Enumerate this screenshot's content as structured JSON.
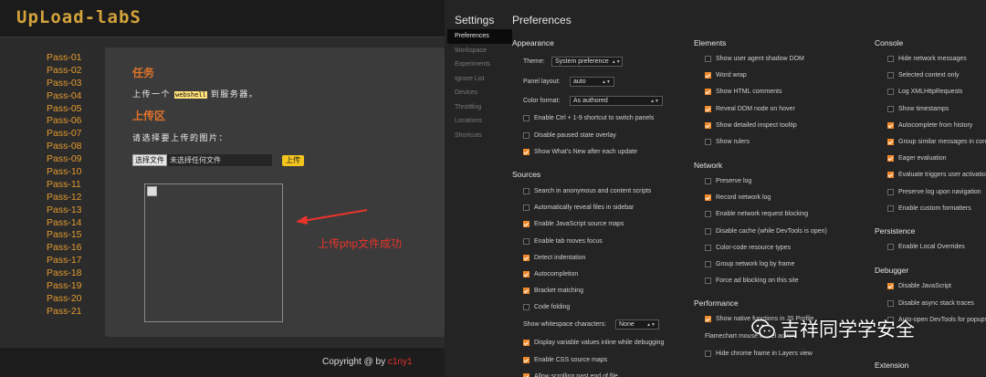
{
  "left": {
    "logo": "UpLoad-labS",
    "pass_items": [
      "Pass-01",
      "Pass-02",
      "Pass-03",
      "Pass-04",
      "Pass-05",
      "Pass-06",
      "Pass-07",
      "Pass-08",
      "Pass-09",
      "Pass-10",
      "Pass-11",
      "Pass-12",
      "Pass-13",
      "Pass-14",
      "Pass-15",
      "Pass-16",
      "Pass-17",
      "Pass-18",
      "Pass-19",
      "Pass-20",
      "Pass-21"
    ],
    "task_heading": "任务",
    "task_text_before": "上传一个",
    "task_code": "webshell",
    "task_text_after": "到服务器。",
    "upload_heading": "上传区",
    "upload_prompt": "请选择要上传的图片：",
    "choose_file_button": "选择文件",
    "no_file_text": "未选择任何文件",
    "upload_button": "上传",
    "annotation": "上传php文件成功",
    "copyright": "Copyright @  by",
    "author": "c1ny1"
  },
  "devtools": {
    "settings_title": "Settings",
    "preferences_title": "Preferences",
    "nav": [
      "Preferences",
      "Workspace",
      "Experiments",
      "Ignore List",
      "Devices",
      "Throttling",
      "Locations",
      "Shortcuts"
    ],
    "appearance": {
      "heading": "Appearance",
      "theme_label": "Theme:",
      "theme_value": "System preference",
      "panel_layout_label": "Panel layout:",
      "panel_layout_value": "auto",
      "color_format_label": "Color format:",
      "color_format_value": "As authored",
      "options": [
        {
          "label": "Enable Ctrl + 1-9 shortcut to switch panels",
          "checked": false
        },
        {
          "label": "Disable paused state overlay",
          "checked": false
        },
        {
          "label": "Show What's New after each update",
          "checked": true
        }
      ]
    },
    "sources": {
      "heading": "Sources",
      "options": [
        {
          "label": "Search in anonymous and content scripts",
          "checked": false
        },
        {
          "label": "Automatically reveal files in sidebar",
          "checked": false
        },
        {
          "label": "Enable JavaScript source maps",
          "checked": true
        },
        {
          "label": "Enable tab moves focus",
          "checked": false
        },
        {
          "label": "Detect indentation",
          "checked": true
        },
        {
          "label": "Autocompletion",
          "checked": true
        },
        {
          "label": "Bracket matching",
          "checked": true
        },
        {
          "label": "Code folding",
          "checked": false
        }
      ],
      "whitespace_label": "Show whitespace characters:",
      "whitespace_value": "None",
      "options2": [
        {
          "label": "Display variable values inline while debugging",
          "checked": true
        },
        {
          "label": "Enable CSS source maps",
          "checked": true
        },
        {
          "label": "Allow scrolling past end of file",
          "checked": true
        }
      ]
    },
    "elements": {
      "heading": "Elements",
      "options": [
        {
          "label": "Show user agent shadow DOM",
          "checked": false
        },
        {
          "label": "Word wrap",
          "checked": true
        },
        {
          "label": "Show HTML comments",
          "checked": true
        },
        {
          "label": "Reveal DOM node on hover",
          "checked": true
        },
        {
          "label": "Show detailed inspect tooltip",
          "checked": true
        },
        {
          "label": "Show rulers",
          "checked": false
        }
      ]
    },
    "network": {
      "heading": "Network",
      "options": [
        {
          "label": "Preserve log",
          "checked": false
        },
        {
          "label": "Record network log",
          "checked": true
        },
        {
          "label": "Enable network request blocking",
          "checked": false
        },
        {
          "label": "Disable cache (while DevTools is open)",
          "checked": false
        },
        {
          "label": "Color-code resource types",
          "checked": false
        },
        {
          "label": "Group network log by frame",
          "checked": false
        },
        {
          "label": "Force ad blocking on this site",
          "checked": false
        }
      ]
    },
    "performance": {
      "heading": "Performance",
      "options": [
        {
          "label": "Show native functions in JS Profile",
          "checked": true
        },
        {
          "label": "Flamechart mouse wheel action:",
          "checked": null
        },
        {
          "label": "Hide chrome frame in Layers view",
          "checked": false
        }
      ]
    },
    "console": {
      "heading": "Console",
      "options": [
        {
          "label": "Hide network messages",
          "checked": false
        },
        {
          "label": "Selected context only",
          "checked": false
        },
        {
          "label": "Log XMLHttpRequests",
          "checked": false
        },
        {
          "label": "Show timestamps",
          "checked": false
        },
        {
          "label": "Autocomplete from history",
          "checked": true
        },
        {
          "label": "Group similar messages in console",
          "checked": true
        },
        {
          "label": "Eager evaluation",
          "checked": true
        },
        {
          "label": "Evaluate triggers user activation",
          "checked": true
        },
        {
          "label": "Preserve log upon navigation",
          "checked": false
        },
        {
          "label": "Enable custom formatters",
          "checked": false
        }
      ]
    },
    "persistence": {
      "heading": "Persistence",
      "options": [
        {
          "label": "Enable Local Overrides",
          "checked": false
        }
      ]
    },
    "debugger": {
      "heading": "Debugger",
      "options": [
        {
          "label": "Disable JavaScript",
          "checked": true
        },
        {
          "label": "Disable async stack traces",
          "checked": false
        },
        {
          "label": "Auto-open DevTools for popups",
          "checked": false
        }
      ]
    },
    "extension": {
      "heading": "Extension"
    }
  },
  "watermark": "吉祥同学学安全",
  "colors": {
    "accent_orange": "#ee8a2b",
    "pass_link": "#e39a2f",
    "heading_orange": "#e2722a",
    "annotation_red": "#e8342b"
  }
}
